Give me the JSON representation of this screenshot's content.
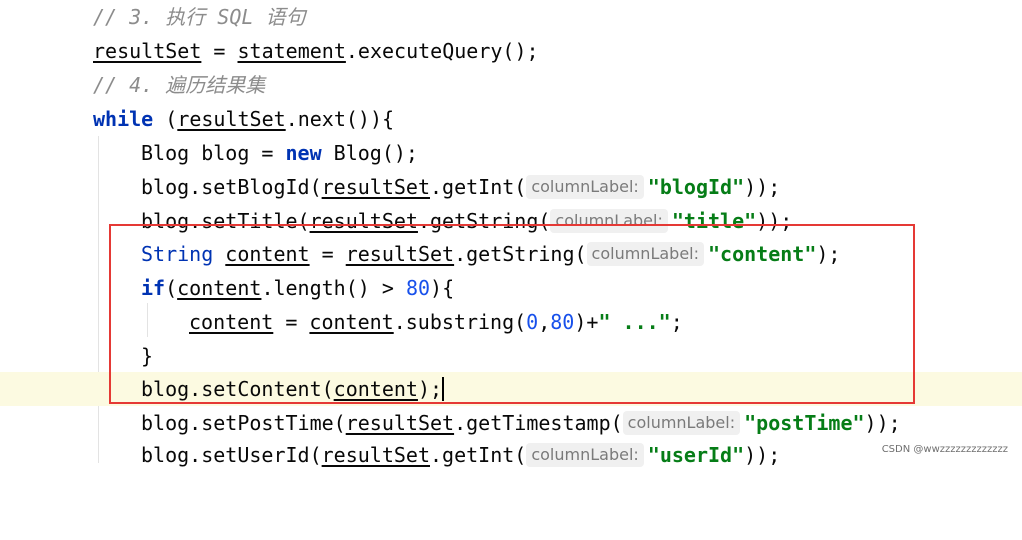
{
  "editor": {
    "language": "Java",
    "lines": [
      {
        "key": "comment3",
        "text": "// 3. 执行 SQL 语句"
      },
      {
        "key": "execute_query",
        "result_var": "resultSet",
        "assign": " = ",
        "object": "statement",
        "call": ".executeQuery();"
      },
      {
        "key": "comment4",
        "text": "// 4. 遍历结果集"
      },
      {
        "key": "while_loop",
        "keyword": "while",
        "open": " (",
        "var": "resultSet",
        "call": ".next()){"
      },
      {
        "key": "new_blog",
        "pre": "Blog blog = ",
        "keyword": "new",
        "post": " Blog();"
      },
      {
        "key": "set_blog_id",
        "pre": "blog.setBlogId(",
        "var": "resultSet",
        "call": ".getInt(",
        "hint": "columnLabel:",
        "str": "\"blogId\"",
        "post": "));"
      },
      {
        "key": "set_title",
        "pre": "blog.setTitle(",
        "var": "resultSet",
        "call": ".getString(",
        "hint": "columnLabel:",
        "str": "\"title\"",
        "post": "));"
      },
      {
        "key": "string_content",
        "type": "String",
        "var": "content",
        "assign": " = ",
        "object": "resultSet",
        "call": ".getString(",
        "hint": "columnLabel:",
        "str": "\"content\"",
        "post": ");"
      },
      {
        "key": "if_length",
        "keyword": "if",
        "open": "(",
        "var": "content",
        "call": ".length() > ",
        "num": "80",
        "post": "){"
      },
      {
        "key": "substring",
        "var": "content",
        "assign": " = ",
        "object": "content",
        "call": ".substring(",
        "num1": "0",
        "comma": ",",
        "num2": "80",
        "mid": ")+",
        "str": "\" ...\"",
        "post": ";"
      },
      {
        "key": "close_brace",
        "text": "}"
      },
      {
        "key": "set_content",
        "pre": "blog.setContent(",
        "var": "content",
        "post": ");"
      },
      {
        "key": "set_post_time",
        "pre": "blog.setPostTime(",
        "var": "resultSet",
        "call": ".getTimestamp(",
        "hint": "columnLabel:",
        "str": "\"postTime\"",
        "post": "));"
      },
      {
        "key": "set_user_id",
        "pre": "blog.setUserId(",
        "var": "resultSet",
        "call": ".getInt(",
        "hint": "columnLabel:",
        "str": "\"userId\"",
        "post": "));"
      }
    ]
  },
  "watermark": "CSDN @wwzzzzzzzzzzzzz",
  "colors": {
    "keyword": "#0033b3",
    "number": "#1750eb",
    "string": "#067d17",
    "comment": "#8c8c8c",
    "hint_bg": "#f0f0f0",
    "current_line": "#fcfae1",
    "annotation_box": "#e53935"
  }
}
